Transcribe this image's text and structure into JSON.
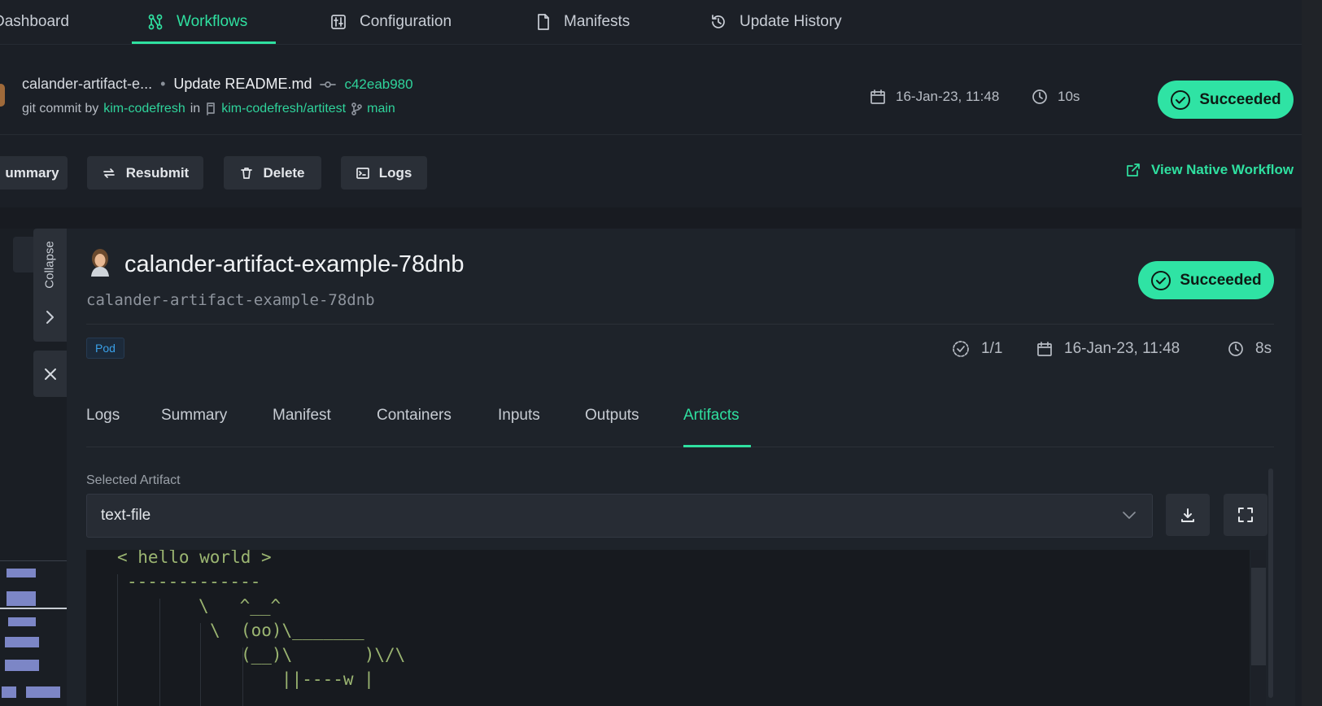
{
  "nav": {
    "items": [
      {
        "label": "Dashboard",
        "icon": "dashboard-icon"
      },
      {
        "label": "Workflows",
        "icon": "workflows-icon",
        "active": true
      },
      {
        "label": "Configuration",
        "icon": "configuration-icon"
      },
      {
        "label": "Manifests",
        "icon": "file-icon"
      },
      {
        "label": "Update History",
        "icon": "history-icon"
      }
    ]
  },
  "workflow": {
    "name": "calander-artifact-e...",
    "commit_message": "Update README.md",
    "commit_hash": "c42eab980",
    "commit_by_prefix": "git commit by",
    "author": "kim-codefresh",
    "in_word": "in",
    "repo": "kim-codefresh/artitest",
    "branch": "main",
    "date": "16-Jan-23, 11:48",
    "duration": "10s",
    "status": "Succeeded"
  },
  "actions": {
    "summary": "ummary",
    "resubmit": "Resubmit",
    "delete": "Delete",
    "logs": "Logs",
    "view_native": "View Native Workflow"
  },
  "side": {
    "collapse": "Collapse"
  },
  "node": {
    "title": "calander-artifact-example-78dnb",
    "subtitle": "calander-artifact-example-78dnb",
    "status": "Succeeded",
    "type_badge": "Pod",
    "steps": "1/1",
    "date": "16-Jan-23, 11:48",
    "duration": "8s"
  },
  "tabs": [
    "Logs",
    "Summary",
    "Manifest",
    "Containers",
    "Inputs",
    "Outputs",
    "Artifacts"
  ],
  "artifact": {
    "label": "Selected Artifact",
    "selected": "text-file",
    "content": [
      "< hello world >",
      "-------------",
      "\\   ^__^",
      "\\  (oo)\\_______",
      "(__)\\       )\\/\\",
      "||----w |"
    ]
  },
  "colors": {
    "accent": "#2fe0a0",
    "success": "#2fe3a4",
    "background": "#1b1f26",
    "panel": "#1e232a"
  }
}
